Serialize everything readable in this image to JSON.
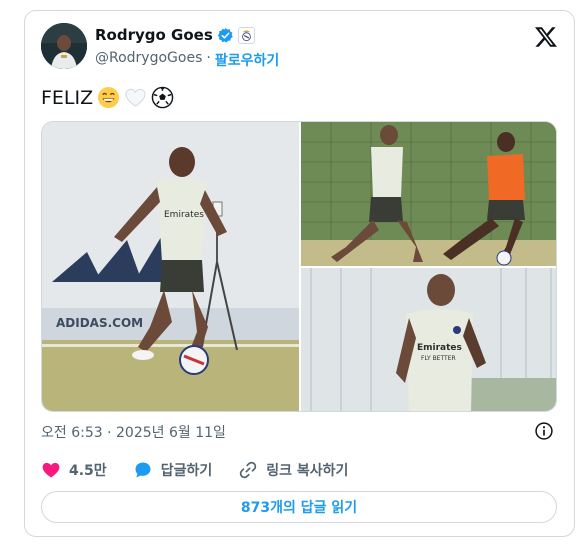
{
  "author": {
    "name": "Rodrygo Goes",
    "handle": "@RodrygoGoes",
    "separator": "·",
    "follow_label": "팔로우하기"
  },
  "tweet": {
    "text": "FELIZ",
    "emojis": [
      "grinning-face",
      "white-heart",
      "soccer-ball"
    ],
    "timestamp": "오전 6:53 · 2025년 6월 11일"
  },
  "media": {
    "photos": [
      {
        "name": "photo-player-dribbling"
      },
      {
        "name": "photo-training-duel"
      },
      {
        "name": "photo-player-running"
      }
    ],
    "shirt_text": "Emirates",
    "shirt_subtext": "FLY BETTER",
    "ad_text": "ADIDAS.COM"
  },
  "actions": {
    "like_count": "4.5만",
    "reply_label": "답글하기",
    "copy_link_label": "링크 복사하기"
  },
  "read_replies_label": "873개의 답글 읽기",
  "colors": {
    "accent": "#1d9bf0",
    "like": "#f91880",
    "text": "#0f1419",
    "muted": "#536471",
    "border": "#cfd9de"
  }
}
